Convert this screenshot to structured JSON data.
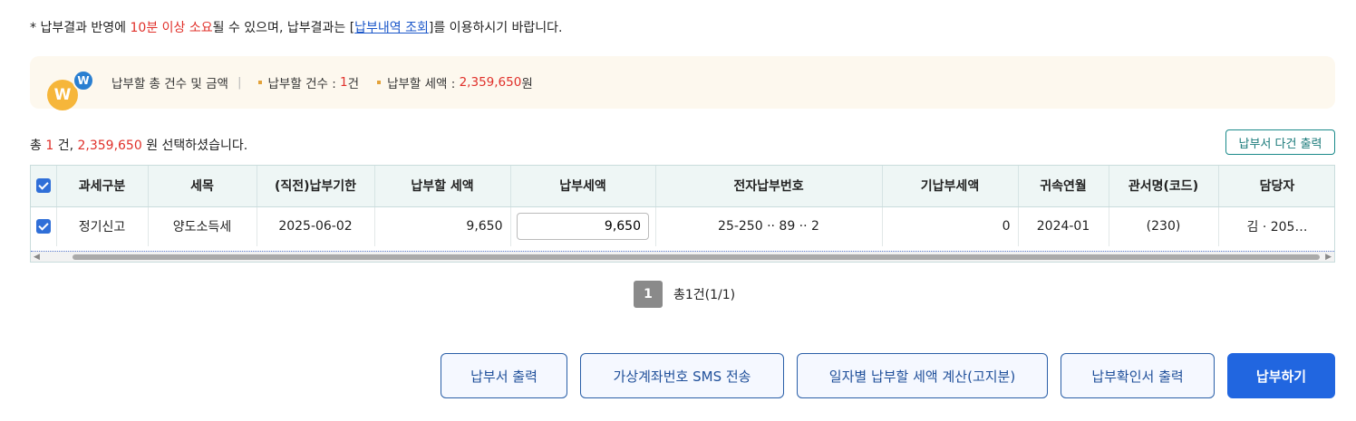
{
  "notice": {
    "prefix": "* 납부결과 반영에 ",
    "highlight": "10분 이상 소요",
    "middle": "될 수 있으며, 납부결과는 [",
    "link": "납부내역 조회",
    "suffix": "]를 이용하시기 바랍니다."
  },
  "summary": {
    "coin_main": "W",
    "coin_badge": "W",
    "title": "납부할 총 건수 및 금액",
    "separator": "|",
    "count_label": "납부할 건수 : ",
    "count_value": "1",
    "count_unit": " 건",
    "amount_label": "납부할 세액 : ",
    "amount_value": "2,359,650",
    "amount_unit": " 원"
  },
  "selection": {
    "prefix": "총 ",
    "count": "1",
    "mid": " 건, ",
    "amount": "2,359,650",
    "suffix": " 원 선택하셨습니다."
  },
  "multi_print_label": "납부서 다건 출력",
  "table": {
    "headers": [
      "과세구분",
      "세목",
      "(직전)납부기한",
      "납부할 세액",
      "납부세액",
      "전자납부번호",
      "기납부세액",
      "귀속연월",
      "관서명(코드)",
      "담당자"
    ],
    "rows": [
      {
        "category": "정기신고",
        "tax_item": "양도소득세",
        "due_date": "2025-06-02",
        "tax_due": "9,650",
        "pay_amount": "9,650",
        "e_payment_no": "25-250 ·· 89 ·· 2",
        "prepaid": "0",
        "period": "2024-01",
        "office": "(230)",
        "manager": "김 · 205…"
      }
    ]
  },
  "pager": {
    "current": "1",
    "total": "총1건(1/1)"
  },
  "buttons": {
    "print": "납부서 출력",
    "sms": "가상계좌번호 SMS 전송",
    "daily_calc": "일자별 납부할 세액 계산(고지분)",
    "confirm_print": "납부확인서 출력",
    "pay": "납부하기"
  }
}
